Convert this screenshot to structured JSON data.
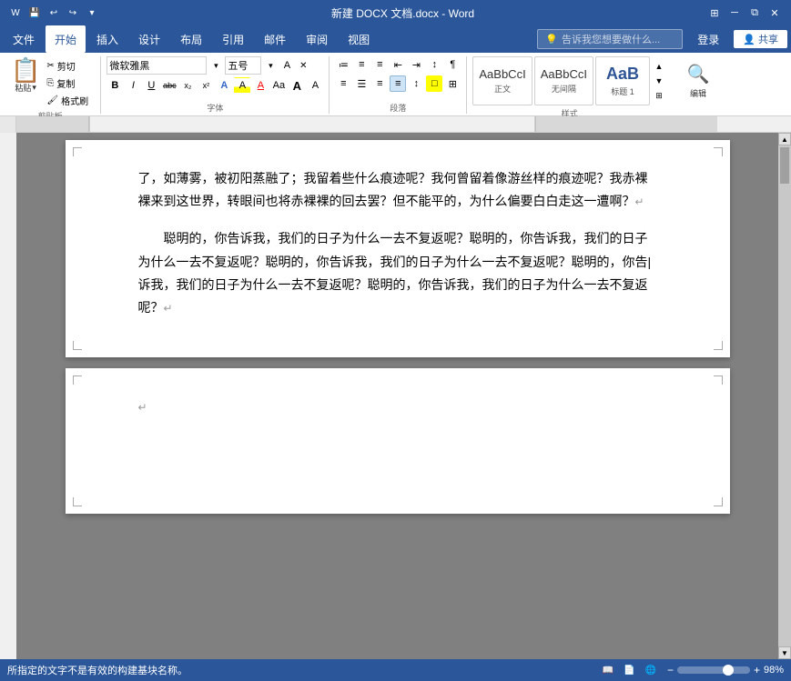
{
  "titlebar": {
    "title": "新建 DOCX 文档.docx - Word",
    "quick_access": [
      "undo",
      "redo",
      "customize"
    ],
    "window_controls": [
      "minimize",
      "restore",
      "close"
    ]
  },
  "menubar": {
    "items": [
      "文件",
      "开始",
      "插入",
      "设计",
      "布局",
      "引用",
      "邮件",
      "审阅",
      "视图"
    ],
    "active": "开始",
    "search_placeholder": "告诉我您想要做什么...",
    "login": "登录",
    "share": "共享"
  },
  "ribbon": {
    "clipboard": {
      "label": "剪贴板",
      "paste": "粘贴",
      "cut": "剪切",
      "copy": "复制",
      "format_painter": "格式刷"
    },
    "font": {
      "label": "字体",
      "name": "微软雅黑",
      "size": "五号",
      "bold": "B",
      "italic": "I",
      "underline": "U",
      "strikethrough": "abc",
      "subscript": "x₂",
      "superscript": "x²",
      "text_effects": "A",
      "highlight": "A",
      "color": "A",
      "case": "Aa",
      "grow": "A",
      "shrink": "A",
      "clear": "A"
    },
    "paragraph": {
      "label": "段落",
      "bullets": "≡",
      "numbering": "≡",
      "multilevel": "≡",
      "decrease_indent": "≡",
      "increase_indent": "≡",
      "sort": "↕",
      "show_marks": "¶",
      "align_left": "≡",
      "align_center": "≡",
      "align_right": "≡",
      "justify": "≡",
      "line_spacing": "≡",
      "shading": "□",
      "borders": "□"
    },
    "styles": {
      "label": "样式",
      "items": [
        {
          "name": "正文",
          "preview": "AaBbCcI"
        },
        {
          "name": "无间隔",
          "preview": "AaBbCcI"
        },
        {
          "name": "标题 1",
          "preview": "AaB"
        }
      ]
    },
    "editing": {
      "label": "编辑",
      "icon": "🔍"
    }
  },
  "document": {
    "page1": {
      "content": [
        "了，如薄雾，被初阳蒸融了；我留着些什么痕迹呢？我何曾留着像游丝样的痕迹呢？我赤裸裸来到这世界，转眼间也将赤裸裸的回去罢？但不能平的，为什么偏要白白走这一遭啊？",
        "聪明的，你告诉我，我们的日子为什么一去不复返呢？聪明的，你告诉我，我们的日子为什么一去不复返呢？聪明的，你告诉我，我们的日子为什么一去不复返呢？聪明的，你告诉我，我们的日子为什么一去不复返呢？聪明的，你告诉我，我们的日子为什么一去不复返呢？"
      ]
    },
    "page2": {
      "content": []
    }
  },
  "statusbar": {
    "error_text": "所指定的文字不是有效的构建基块名称。",
    "page_info": "",
    "zoom": "98%",
    "view_buttons": [
      "阅读",
      "页面",
      "Web"
    ]
  }
}
